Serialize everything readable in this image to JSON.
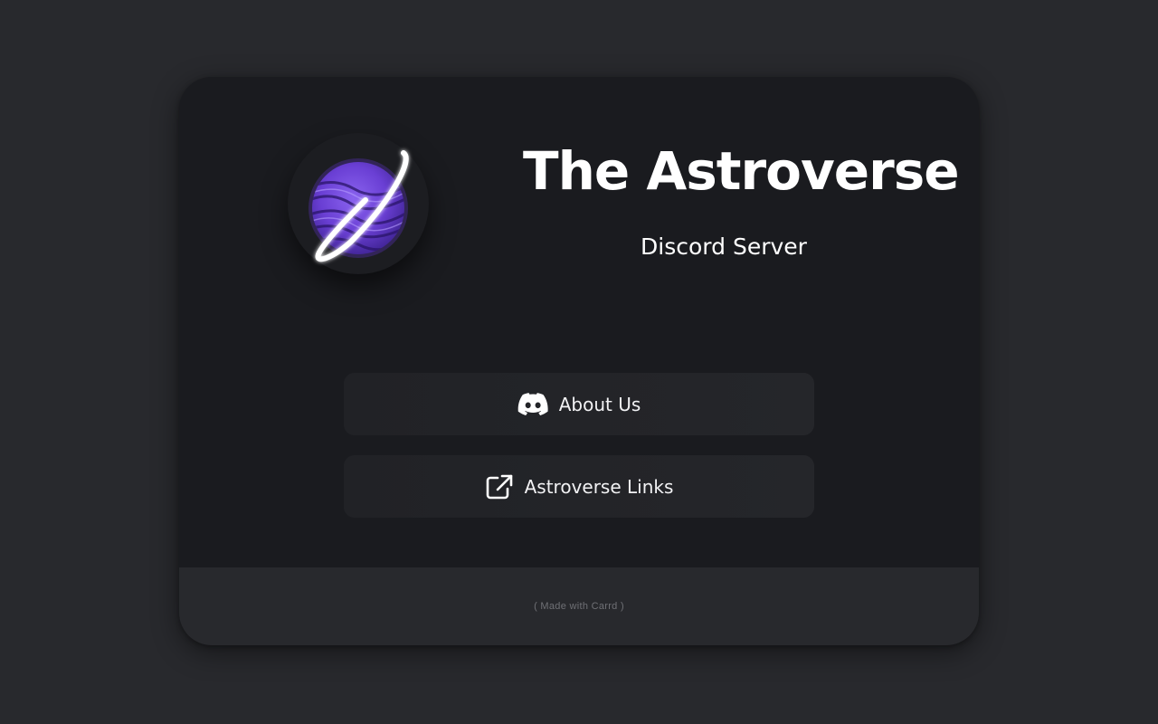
{
  "page": {
    "background": "#28292d",
    "card_background": "#1a1b1f",
    "footer_background": "#28292d"
  },
  "header": {
    "title": "The Astroverse",
    "subtitle": "Discord Server",
    "logo_icon": "planet-ring-icon",
    "logo_colors": {
      "planet": "#6a3fd4",
      "ring": "#ffffff"
    }
  },
  "buttons": [
    {
      "label": "About Us",
      "icon": "discord-icon"
    },
    {
      "label": "Astroverse Links",
      "icon": "external-link-icon"
    }
  ],
  "footer": {
    "credit": "( Made with Carrd )"
  }
}
